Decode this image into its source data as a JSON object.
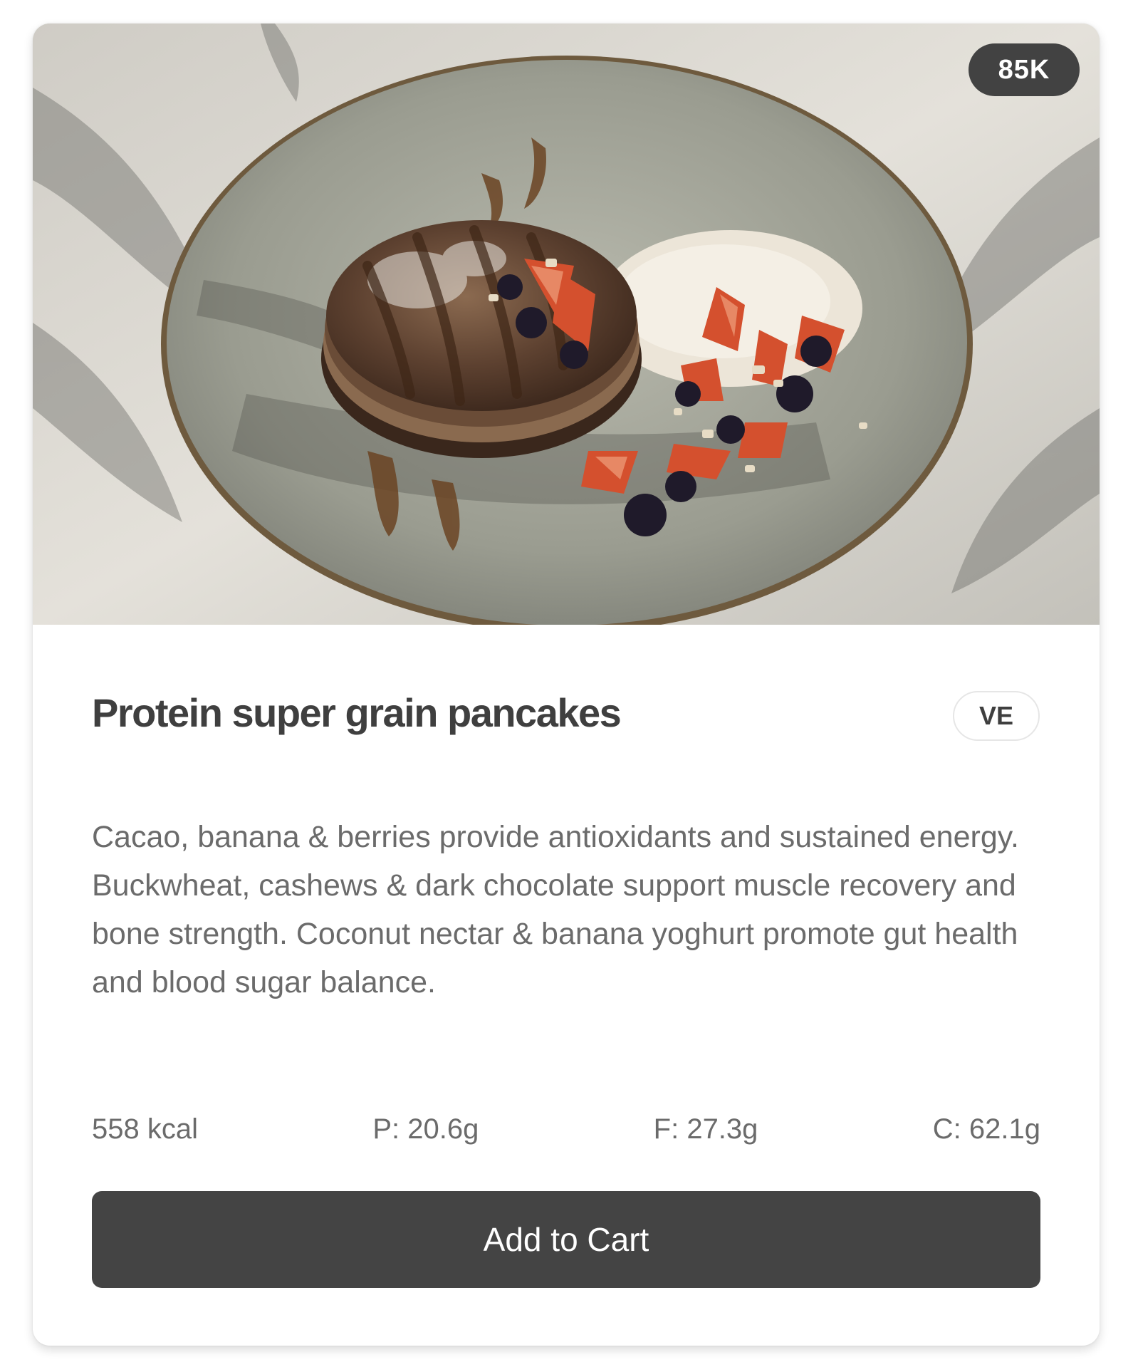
{
  "product": {
    "view_count": "85K",
    "title": "Protein super grain pancakes",
    "diet_tag": "VE",
    "description": "Cacao, banana & berries provide antioxidants and sustained energy. Buckwheat, cashews & dark chocolate support muscle recovery and bone strength. Coconut nectar & banana yoghurt promote gut health and blood sugar balance.",
    "nutrition": {
      "calories": "558 kcal",
      "protein": "P: 20.6g",
      "fat": "F: 27.3g",
      "carbs": "C: 62.1g"
    },
    "cart_button_label": "Add to Cart"
  },
  "colors": {
    "badge_bg": "#424242",
    "button_bg": "#444444",
    "title_text": "#3f3f3f",
    "body_text": "#6b6b6b"
  }
}
